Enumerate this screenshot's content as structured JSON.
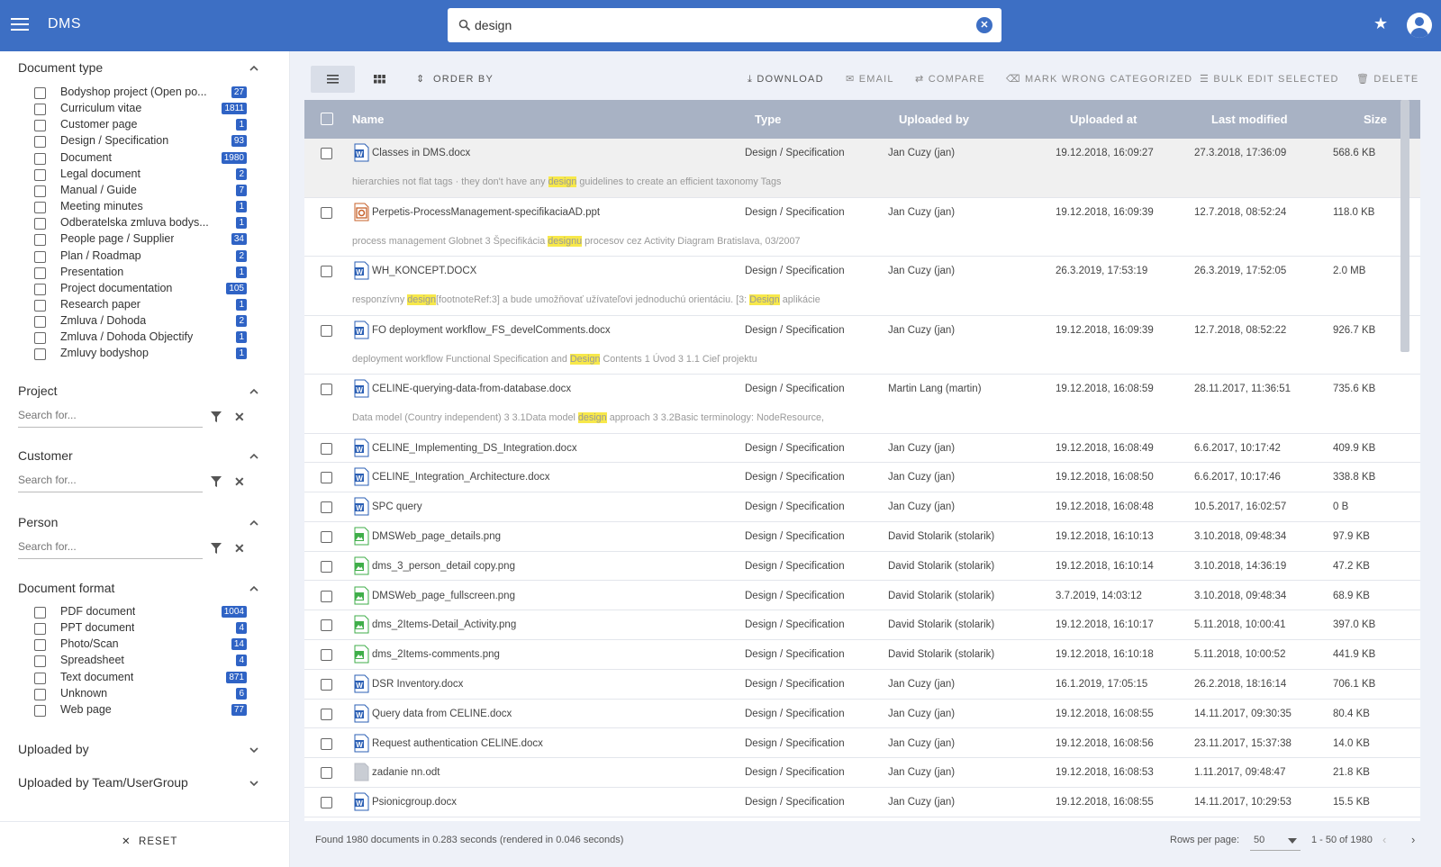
{
  "app": {
    "title": "DMS"
  },
  "search": {
    "value": "design",
    "placeholder": ""
  },
  "sidebar": {
    "document_type": {
      "title": "Document type",
      "items": [
        {
          "label": "Bodyshop project (Open po...",
          "count": "27"
        },
        {
          "label": "Curriculum vitae",
          "count": "1811"
        },
        {
          "label": "Customer page",
          "count": "1"
        },
        {
          "label": "Design / Specification",
          "count": "93"
        },
        {
          "label": "Document",
          "count": "1980"
        },
        {
          "label": "Legal document",
          "count": "2"
        },
        {
          "label": "Manual / Guide",
          "count": "7"
        },
        {
          "label": "Meeting minutes",
          "count": "1"
        },
        {
          "label": "Odberatelska zmluva bodys...",
          "count": "1"
        },
        {
          "label": "People page / Supplier",
          "count": "34"
        },
        {
          "label": "Plan / Roadmap",
          "count": "2"
        },
        {
          "label": "Presentation",
          "count": "1"
        },
        {
          "label": "Project documentation",
          "count": "105"
        },
        {
          "label": "Research paper",
          "count": "1"
        },
        {
          "label": "Zmluva / Dohoda",
          "count": "2"
        },
        {
          "label": "Zmluva / Dohoda Objectify",
          "count": "1"
        },
        {
          "label": "Zmluvy bodyshop",
          "count": "1"
        }
      ]
    },
    "project": {
      "title": "Project",
      "placeholder": "Search for..."
    },
    "customer": {
      "title": "Customer",
      "placeholder": "Search for..."
    },
    "person": {
      "title": "Person",
      "placeholder": "Search for..."
    },
    "document_format": {
      "title": "Document format",
      "items": [
        {
          "label": "PDF document",
          "count": "1004"
        },
        {
          "label": "PPT document",
          "count": "4"
        },
        {
          "label": "Photo/Scan",
          "count": "14"
        },
        {
          "label": "Spreadsheet",
          "count": "4"
        },
        {
          "label": "Text document",
          "count": "871"
        },
        {
          "label": "Unknown",
          "count": "6"
        },
        {
          "label": "Web page",
          "count": "77"
        }
      ]
    },
    "uploaded_by": {
      "title": "Uploaded by"
    },
    "uploaded_by_team": {
      "title": "Uploaded by Team/UserGroup"
    },
    "reset_label": "RESET"
  },
  "toolbar": {
    "order_by": "ORDER BY",
    "download": "DOWNLOAD",
    "email": "EMAIL",
    "compare": "COMPARE",
    "mark_wrong": "MARK WRONG CATEGORIZED",
    "bulk_edit": "BULK EDIT SELECTED",
    "delete": "DELETE"
  },
  "table": {
    "headers": {
      "name": "Name",
      "type": "Type",
      "uploaded_by": "Uploaded by",
      "uploaded_at": "Uploaded at",
      "last_modified": "Last modified",
      "size": "Size"
    },
    "rows": [
      {
        "icon": "word",
        "name": "Classes in DMS.docx",
        "type": "Design / Specification",
        "uploaded_by": "Jan Cuzy (jan)",
        "uploaded_at": "19.12.2018, 16:09:27",
        "last_modified": "27.3.2018, 17:36:09",
        "size": "568.6 KB",
        "snippet": {
          "pre": "hierarchies not flat tags · they don't have any ",
          "hit": "design",
          "post": " guidelines to create an efficient taxonomy Tags",
          "hit2": "",
          "post2": ""
        }
      },
      {
        "icon": "ppt",
        "name": "Perpetis-ProcessManagement-specifikaciaAD.ppt",
        "type": "Design / Specification",
        "uploaded_by": "Jan Cuzy (jan)",
        "uploaded_at": "19.12.2018, 16:09:39",
        "last_modified": "12.7.2018, 08:52:24",
        "size": "118.0 KB",
        "snippet": {
          "pre": "process management Globnet 3 Špecifikácia ",
          "hit": "designu",
          "post": " procesov cez Activity Diagram Bratislava, 03/2007",
          "hit2": "",
          "post2": ""
        }
      },
      {
        "icon": "word",
        "name": "WH_KONCEPT.DOCX",
        "type": "Design / Specification",
        "uploaded_by": "Jan Cuzy (jan)",
        "uploaded_at": "26.3.2019, 17:53:19",
        "last_modified": "26.3.2019, 17:52:05",
        "size": "2.0 MB",
        "snippet": {
          "pre": "responzívny ",
          "hit": "design",
          "post": "[footnoteRef:3] a bude umožňovať užívateľovi jednoduchú orientáciu. [3: ",
          "hit2": "Design",
          "post2": " aplikácie"
        }
      },
      {
        "icon": "word",
        "name": "FO deployment workflow_FS_develComments.docx",
        "type": "Design / Specification",
        "uploaded_by": "Jan Cuzy (jan)",
        "uploaded_at": "19.12.2018, 16:09:39",
        "last_modified": "12.7.2018, 08:52:22",
        "size": "926.7 KB",
        "snippet": {
          "pre": "deployment workflow Functional Specification and ",
          "hit": "Design",
          "post": " Contents 1 Úvod 3 1.1 Cieľ projektu",
          "hit2": "",
          "post2": ""
        }
      },
      {
        "icon": "word",
        "name": "CELINE-querying-data-from-database.docx",
        "type": "Design / Specification",
        "uploaded_by": "Martin Lang (martin)",
        "uploaded_at": "19.12.2018, 16:08:59",
        "last_modified": "28.11.2017, 11:36:51",
        "size": "735.6 KB",
        "snippet": {
          "pre": "Data model (Country independent) 3 3.1Data model ",
          "hit": "design",
          "post": " approach 3 3.2Basic terminology: NodeResource,",
          "hit2": "",
          "post2": ""
        }
      },
      {
        "icon": "word",
        "name": "CELINE_Implementing_DS_Integration.docx",
        "type": "Design / Specification",
        "uploaded_by": "Jan Cuzy (jan)",
        "uploaded_at": "19.12.2018, 16:08:49",
        "last_modified": "6.6.2017, 10:17:42",
        "size": "409.9 KB"
      },
      {
        "icon": "word",
        "name": "CELINE_Integration_Architecture.docx",
        "type": "Design / Specification",
        "uploaded_by": "Jan Cuzy (jan)",
        "uploaded_at": "19.12.2018, 16:08:50",
        "last_modified": "6.6.2017, 10:17:46",
        "size": "338.8 KB"
      },
      {
        "icon": "word",
        "name": "SPC query",
        "type": "Design / Specification",
        "uploaded_by": "Jan Cuzy (jan)",
        "uploaded_at": "19.12.2018, 16:08:48",
        "last_modified": "10.5.2017, 16:02:57",
        "size": "0 B"
      },
      {
        "icon": "image",
        "name": "DMSWeb_page_details.png",
        "type": "Design / Specification",
        "uploaded_by": "David Stolarik (stolarik)",
        "uploaded_at": "19.12.2018, 16:10:13",
        "last_modified": "3.10.2018, 09:48:34",
        "size": "97.9 KB"
      },
      {
        "icon": "image",
        "name": "dms_3_person_detail copy.png",
        "type": "Design / Specification",
        "uploaded_by": "David Stolarik (stolarik)",
        "uploaded_at": "19.12.2018, 16:10:14",
        "last_modified": "3.10.2018, 14:36:19",
        "size": "47.2 KB"
      },
      {
        "icon": "image",
        "name": "DMSWeb_page_fullscreen.png",
        "type": "Design / Specification",
        "uploaded_by": "David Stolarik (stolarik)",
        "uploaded_at": "3.7.2019, 14:03:12",
        "last_modified": "3.10.2018, 09:48:34",
        "size": "68.9 KB"
      },
      {
        "icon": "image",
        "name": "dms_2Items-Detail_Activity.png",
        "type": "Design / Specification",
        "uploaded_by": "David Stolarik (stolarik)",
        "uploaded_at": "19.12.2018, 16:10:17",
        "last_modified": "5.11.2018, 10:00:41",
        "size": "397.0 KB"
      },
      {
        "icon": "image",
        "name": "dms_2Items-comments.png",
        "type": "Design / Specification",
        "uploaded_by": "David Stolarik (stolarik)",
        "uploaded_at": "19.12.2018, 16:10:18",
        "last_modified": "5.11.2018, 10:00:52",
        "size": "441.9 KB"
      },
      {
        "icon": "word",
        "name": "DSR Inventory.docx",
        "type": "Design / Specification",
        "uploaded_by": "Jan Cuzy (jan)",
        "uploaded_at": "16.1.2019, 17:05:15",
        "last_modified": "26.2.2018, 18:16:14",
        "size": "706.1 KB"
      },
      {
        "icon": "word",
        "name": "Query data from CELINE.docx",
        "type": "Design / Specification",
        "uploaded_by": "Jan Cuzy (jan)",
        "uploaded_at": "19.12.2018, 16:08:55",
        "last_modified": "14.11.2017, 09:30:35",
        "size": "80.4 KB"
      },
      {
        "icon": "word",
        "name": "Request authentication CELINE.docx",
        "type": "Design / Specification",
        "uploaded_by": "Jan Cuzy (jan)",
        "uploaded_at": "19.12.2018, 16:08:56",
        "last_modified": "23.11.2017, 15:37:38",
        "size": "14.0 KB"
      },
      {
        "icon": "blank",
        "name": "zadanie nn.odt",
        "type": "Design / Specification",
        "uploaded_by": "Jan Cuzy (jan)",
        "uploaded_at": "19.12.2018, 16:08:53",
        "last_modified": "1.11.2017, 09:48:47",
        "size": "21.8 KB"
      },
      {
        "icon": "word",
        "name": "Psionicgroup.docx",
        "type": "Design / Specification",
        "uploaded_by": "Jan Cuzy (jan)",
        "uploaded_at": "19.12.2018, 16:08:55",
        "last_modified": "14.11.2017, 10:29:53",
        "size": "15.5 KB"
      }
    ]
  },
  "footer": {
    "found": "Found 1980 documents in 0.283 seconds (rendered in 0.046 seconds)",
    "rows_per_page_label": "Rows per page:",
    "rows_per_page": "50",
    "range": "1 - 50 of 1980"
  },
  "colors": {
    "primary": "#3d6fc4",
    "badge": "#2f63c5",
    "highlight": "#f7e84a",
    "word": "#2b5fb4",
    "image": "#3fae49",
    "ppt": "#c7602a"
  }
}
